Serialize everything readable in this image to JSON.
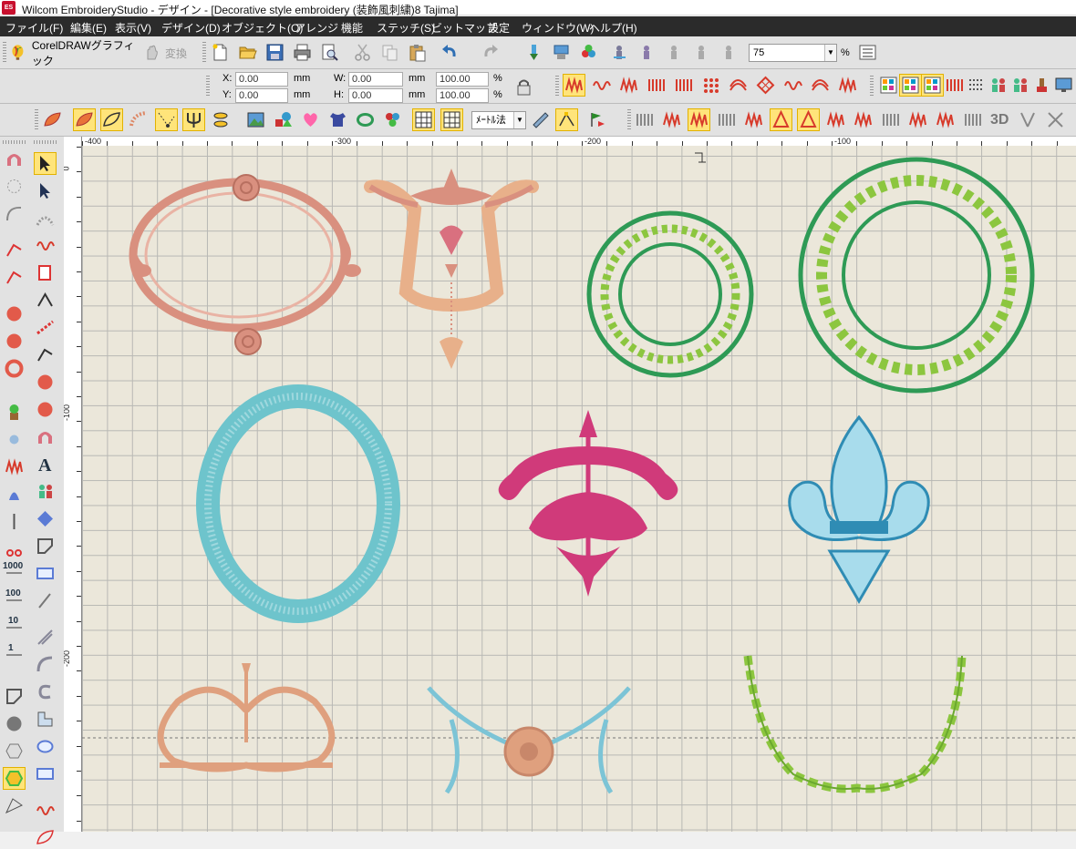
{
  "window": {
    "title": "Wilcom EmbroideryStudio - デザイン - [Decorative style embroidery (装飾風刺繍)8        Tajima]",
    "app_icon": "ES"
  },
  "menu": [
    "ファイル(F)",
    "編集(E)",
    "表示(V)",
    "デザイン(D)",
    "オブジェクト(O)",
    "アレンジ",
    "機能",
    "ステッチ(S)",
    "ビットマップ",
    "設定",
    "ウィンドウ(W)",
    "ヘルプ(H)"
  ],
  "toolbar1": {
    "coreldraw_label": "CorelDRAWグラフィック",
    "convert_label": "変換",
    "zoom_value": "75",
    "zoom_unit": "%"
  },
  "toolbar2": {
    "x_label": "X:",
    "x_value": "0.00",
    "x_unit": "mm",
    "y_label": "Y:",
    "y_value": "0.00",
    "y_unit": "mm",
    "w_label": "W:",
    "w_value": "0.00",
    "w_unit": "mm",
    "h_label": "H:",
    "h_value": "0.00",
    "h_unit": "mm",
    "w_pct": "100.00",
    "h_pct": "100.00",
    "pct": "%"
  },
  "toolbar3": {
    "measure_method": "ﾒｰﾄﾙ法",
    "label_3d": "3D"
  },
  "rulers": {
    "horizontal": [
      "-400",
      "-300",
      "-200",
      "-100"
    ],
    "vertical": [
      "0",
      "-100",
      "-200"
    ]
  },
  "left_tools": {
    "numeric_labels": [
      "1000",
      "100",
      "10",
      "1"
    ],
    "text_tool_glyph": "A"
  },
  "colors": {
    "rose": "#d9907f",
    "peach": "#dfa07e",
    "green_dark": "#2e9a55",
    "green_light": "#8cc63f",
    "teal": "#6ec4cc",
    "magenta": "#d03a7a",
    "blue": "#2f8cb4",
    "sky": "#7cc4d6",
    "canvas_bg": "#ebe7da"
  }
}
